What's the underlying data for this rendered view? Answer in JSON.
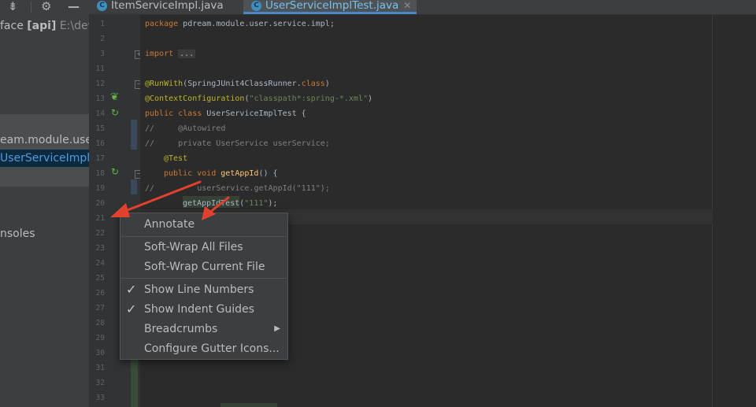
{
  "project_panel": {
    "settings_icon": "gear-icon",
    "collapse_icon": "collapse-all-icon",
    "minimize_icon": "minimize-icon",
    "rows": [
      {
        "prefix": "face ",
        "bold": "[api]",
        "suffix": "E:\\dev"
      },
      {
        "text": "eam.module.user"
      },
      {
        "text": "UserServiceImplT"
      },
      {
        "text": "nsoles"
      }
    ]
  },
  "tabs": [
    {
      "label": "ItemServiceImpl.java",
      "icon": "C"
    },
    {
      "label": "UserServiceImplTest.java",
      "icon": "C",
      "active": true
    }
  ],
  "tab_close_glyph": "✕",
  "line_numbers": [
    "1",
    "2",
    "3",
    "11",
    "12",
    "13",
    "14",
    "15",
    "16",
    "17",
    "18",
    "19",
    "20",
    "21",
    "22",
    "23",
    "24",
    "25",
    "26",
    "27",
    "28",
    "29",
    "30",
    "31",
    "32",
    "33"
  ],
  "code": {
    "line1_kw": "package",
    "line1_rest": " pdream.module.user.service.impl;",
    "line3_kw": "import",
    "line3_dots": "...",
    "line12_an": "@RunWith",
    "line12_rest": "(SpringJUnit4ClassRunner.",
    "line12_kw": "class",
    "line12_end": ")",
    "line13_an": "@ContextConfiguration",
    "line13_p1": "(",
    "line13_str": "\"classpath*:spring-*.xml\"",
    "line13_p2": ")",
    "line14_kw": "public class",
    "line14_rest": " UserServiceImplTest {",
    "line15": "//     @Autowired",
    "line16": "//     private UserService userService;",
    "line17_an": "@Test",
    "line18_kw": "public void",
    "line18_fn": "getAppId",
    "line18_rest": "() {",
    "line19": "//         userService.getAppId(\"111\");",
    "line20_pre": "getAppIdTest(",
    "line20_str": "\"111\"",
    "line20_end": ");"
  },
  "context_menu": {
    "items": [
      {
        "label": "Annotate"
      },
      {
        "label": "Soft-Wrap All Files"
      },
      {
        "label": "Soft-Wrap Current File"
      },
      {
        "label": "Show Line Numbers",
        "checked": true
      },
      {
        "label": "Show Indent Guides",
        "checked": true
      },
      {
        "label": "Breadcrumbs",
        "submenu": true
      },
      {
        "label": "Configure Gutter Icons..."
      }
    ],
    "check_glyph": "✓",
    "arrow_glyph": "▶"
  },
  "colors": {
    "arrow": "#e2412e",
    "accent": "#4a88c7"
  }
}
